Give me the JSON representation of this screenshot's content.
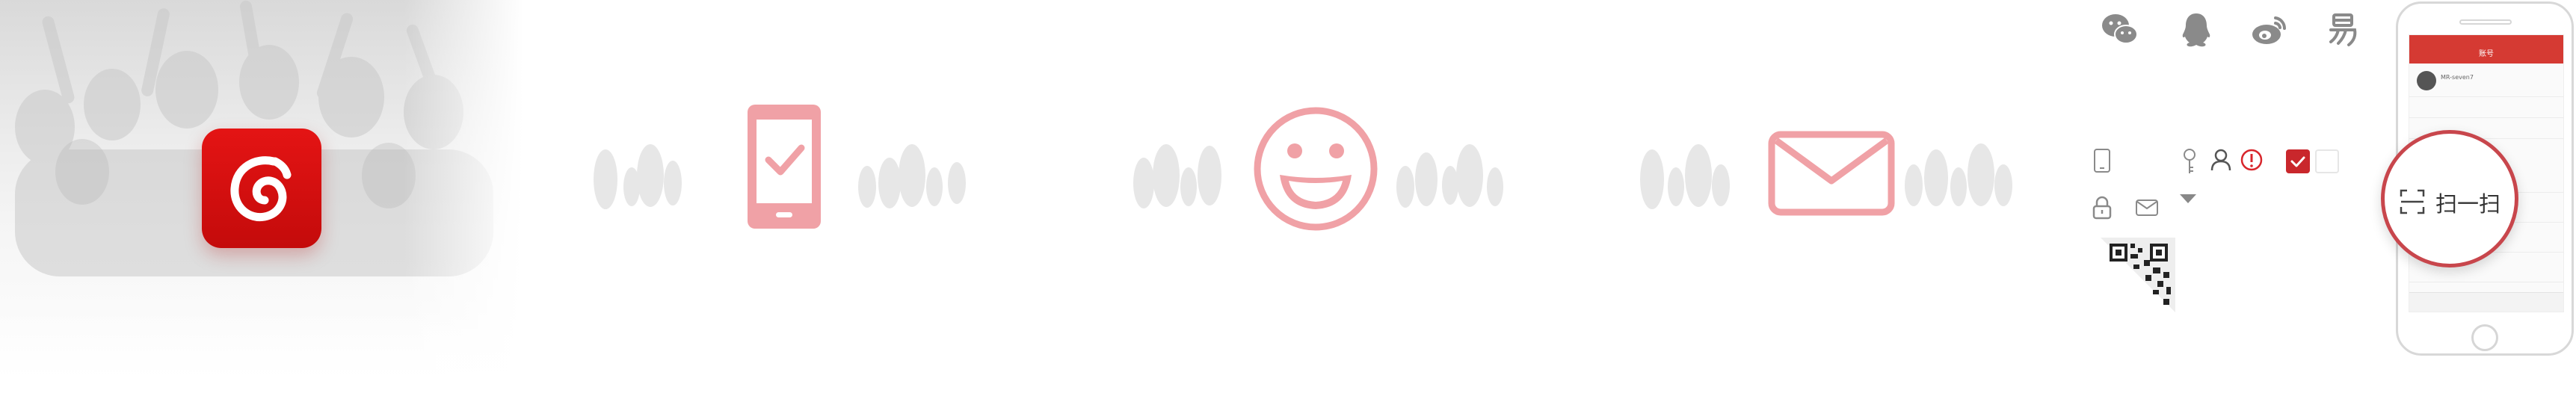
{
  "app": {
    "logo_icon": "netease-cloud-music-icon",
    "brand_color": "#d81e06",
    "accent_pink": "#ef9aa0"
  },
  "illustrations": [
    {
      "icon": "mobile-check-icon"
    },
    {
      "icon": "smiley-face-icon"
    },
    {
      "icon": "envelope-icon"
    }
  ],
  "social": [
    {
      "icon": "wechat-icon"
    },
    {
      "icon": "qq-icon"
    },
    {
      "icon": "weibo-icon"
    },
    {
      "icon": "netease-yi-icon"
    }
  ],
  "sprites": {
    "icons": [
      "phone-small-icon",
      "key-icon",
      "user-icon",
      "warning-icon",
      "lock-icon",
      "mail-small-icon",
      "chevron-down-icon",
      "qr-code-icon"
    ],
    "checkbox_checked_color": "#c9272c"
  },
  "phone": {
    "screen": {
      "header_title": "账号",
      "username": "MR-seven7",
      "scan_label": "扫一扫"
    }
  }
}
